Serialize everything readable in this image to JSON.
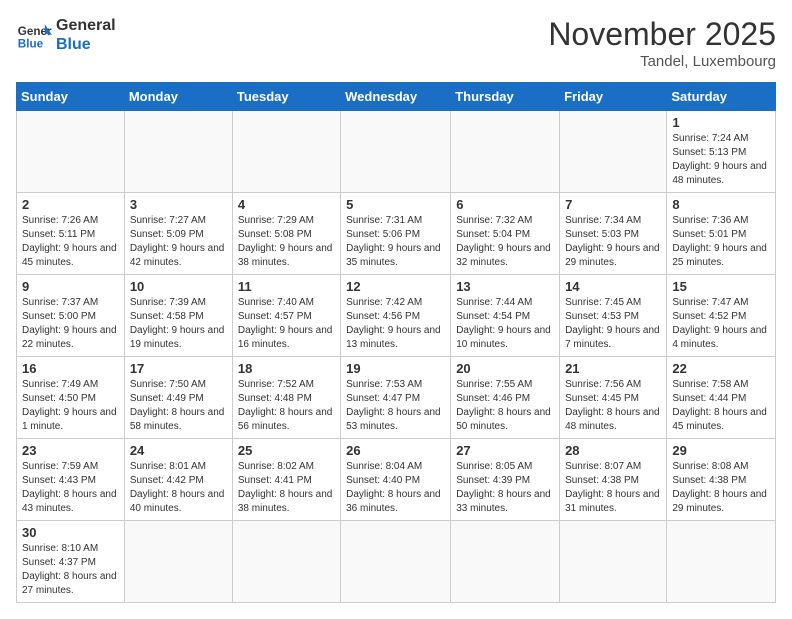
{
  "header": {
    "logo_general": "General",
    "logo_blue": "Blue",
    "month_title": "November 2025",
    "location": "Tandel, Luxembourg"
  },
  "days_of_week": [
    "Sunday",
    "Monday",
    "Tuesday",
    "Wednesday",
    "Thursday",
    "Friday",
    "Saturday"
  ],
  "weeks": [
    [
      {
        "day": "",
        "info": ""
      },
      {
        "day": "",
        "info": ""
      },
      {
        "day": "",
        "info": ""
      },
      {
        "day": "",
        "info": ""
      },
      {
        "day": "",
        "info": ""
      },
      {
        "day": "",
        "info": ""
      },
      {
        "day": "1",
        "info": "Sunrise: 7:24 AM\nSunset: 5:13 PM\nDaylight: 9 hours and 48 minutes."
      }
    ],
    [
      {
        "day": "2",
        "info": "Sunrise: 7:26 AM\nSunset: 5:11 PM\nDaylight: 9 hours and 45 minutes."
      },
      {
        "day": "3",
        "info": "Sunrise: 7:27 AM\nSunset: 5:09 PM\nDaylight: 9 hours and 42 minutes."
      },
      {
        "day": "4",
        "info": "Sunrise: 7:29 AM\nSunset: 5:08 PM\nDaylight: 9 hours and 38 minutes."
      },
      {
        "day": "5",
        "info": "Sunrise: 7:31 AM\nSunset: 5:06 PM\nDaylight: 9 hours and 35 minutes."
      },
      {
        "day": "6",
        "info": "Sunrise: 7:32 AM\nSunset: 5:04 PM\nDaylight: 9 hours and 32 minutes."
      },
      {
        "day": "7",
        "info": "Sunrise: 7:34 AM\nSunset: 5:03 PM\nDaylight: 9 hours and 29 minutes."
      },
      {
        "day": "8",
        "info": "Sunrise: 7:36 AM\nSunset: 5:01 PM\nDaylight: 9 hours and 25 minutes."
      }
    ],
    [
      {
        "day": "9",
        "info": "Sunrise: 7:37 AM\nSunset: 5:00 PM\nDaylight: 9 hours and 22 minutes."
      },
      {
        "day": "10",
        "info": "Sunrise: 7:39 AM\nSunset: 4:58 PM\nDaylight: 9 hours and 19 minutes."
      },
      {
        "day": "11",
        "info": "Sunrise: 7:40 AM\nSunset: 4:57 PM\nDaylight: 9 hours and 16 minutes."
      },
      {
        "day": "12",
        "info": "Sunrise: 7:42 AM\nSunset: 4:56 PM\nDaylight: 9 hours and 13 minutes."
      },
      {
        "day": "13",
        "info": "Sunrise: 7:44 AM\nSunset: 4:54 PM\nDaylight: 9 hours and 10 minutes."
      },
      {
        "day": "14",
        "info": "Sunrise: 7:45 AM\nSunset: 4:53 PM\nDaylight: 9 hours and 7 minutes."
      },
      {
        "day": "15",
        "info": "Sunrise: 7:47 AM\nSunset: 4:52 PM\nDaylight: 9 hours and 4 minutes."
      }
    ],
    [
      {
        "day": "16",
        "info": "Sunrise: 7:49 AM\nSunset: 4:50 PM\nDaylight: 9 hours and 1 minute."
      },
      {
        "day": "17",
        "info": "Sunrise: 7:50 AM\nSunset: 4:49 PM\nDaylight: 8 hours and 58 minutes."
      },
      {
        "day": "18",
        "info": "Sunrise: 7:52 AM\nSunset: 4:48 PM\nDaylight: 8 hours and 56 minutes."
      },
      {
        "day": "19",
        "info": "Sunrise: 7:53 AM\nSunset: 4:47 PM\nDaylight: 8 hours and 53 minutes."
      },
      {
        "day": "20",
        "info": "Sunrise: 7:55 AM\nSunset: 4:46 PM\nDaylight: 8 hours and 50 minutes."
      },
      {
        "day": "21",
        "info": "Sunrise: 7:56 AM\nSunset: 4:45 PM\nDaylight: 8 hours and 48 minutes."
      },
      {
        "day": "22",
        "info": "Sunrise: 7:58 AM\nSunset: 4:44 PM\nDaylight: 8 hours and 45 minutes."
      }
    ],
    [
      {
        "day": "23",
        "info": "Sunrise: 7:59 AM\nSunset: 4:43 PM\nDaylight: 8 hours and 43 minutes."
      },
      {
        "day": "24",
        "info": "Sunrise: 8:01 AM\nSunset: 4:42 PM\nDaylight: 8 hours and 40 minutes."
      },
      {
        "day": "25",
        "info": "Sunrise: 8:02 AM\nSunset: 4:41 PM\nDaylight: 8 hours and 38 minutes."
      },
      {
        "day": "26",
        "info": "Sunrise: 8:04 AM\nSunset: 4:40 PM\nDaylight: 8 hours and 36 minutes."
      },
      {
        "day": "27",
        "info": "Sunrise: 8:05 AM\nSunset: 4:39 PM\nDaylight: 8 hours and 33 minutes."
      },
      {
        "day": "28",
        "info": "Sunrise: 8:07 AM\nSunset: 4:38 PM\nDaylight: 8 hours and 31 minutes."
      },
      {
        "day": "29",
        "info": "Sunrise: 8:08 AM\nSunset: 4:38 PM\nDaylight: 8 hours and 29 minutes."
      }
    ],
    [
      {
        "day": "30",
        "info": "Sunrise: 8:10 AM\nSunset: 4:37 PM\nDaylight: 8 hours and 27 minutes."
      },
      {
        "day": "",
        "info": ""
      },
      {
        "day": "",
        "info": ""
      },
      {
        "day": "",
        "info": ""
      },
      {
        "day": "",
        "info": ""
      },
      {
        "day": "",
        "info": ""
      },
      {
        "day": "",
        "info": ""
      }
    ]
  ]
}
